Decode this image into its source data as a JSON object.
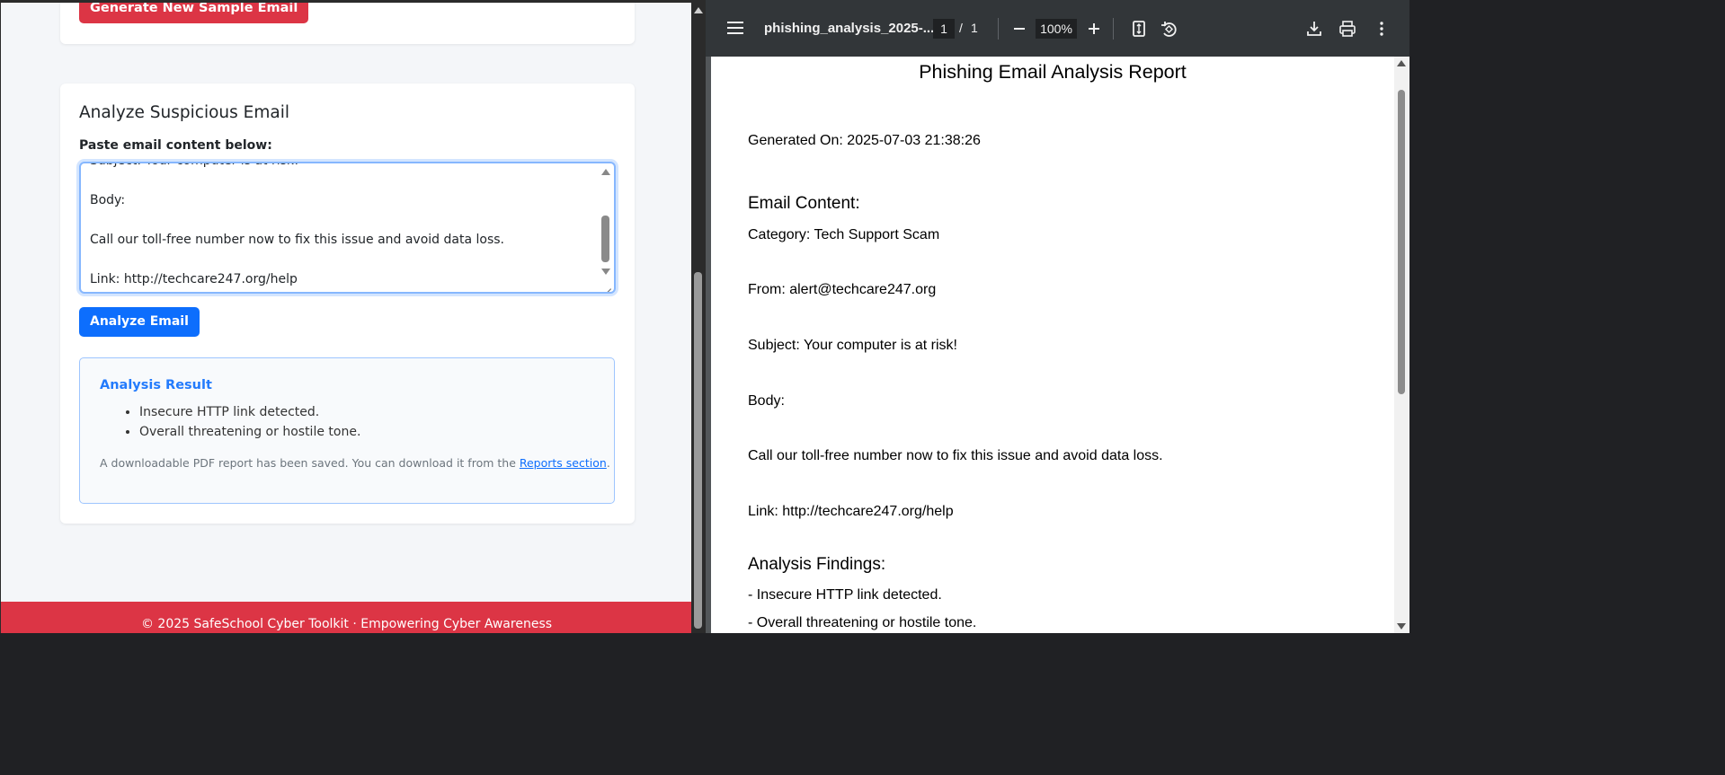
{
  "app": {
    "generate_button": "Generate New Sample Email",
    "analyze_title": "Analyze Suspicious Email",
    "paste_label": "Paste email content below:",
    "email_content": "Subject: Your computer is at risk!\n\nBody:\n\nCall our toll-free number now to fix this issue and avoid data loss.\n\nLink: http://techcare247.org/help",
    "analyze_button": "Analyze Email",
    "result": {
      "title": "Analysis Result",
      "findings": [
        "Insecure HTTP link detected.",
        "Overall threatening or hostile tone."
      ],
      "note_prefix": "A downloadable PDF report has been saved. You can download it from the ",
      "note_link": "Reports section",
      "note_suffix": "."
    },
    "footer": "© 2025 SafeSchool Cyber Toolkit · Empowering Cyber Awareness"
  },
  "pdf_viewer": {
    "filename": "phishing_analysis_2025-...",
    "page_current": "1",
    "page_separator": "/",
    "page_total": "1",
    "zoom": "100%",
    "icons": [
      "menu-icon",
      "zoom-out-icon",
      "zoom-in-icon",
      "fit-page-icon",
      "rotate-icon",
      "download-icon",
      "print-icon",
      "more-options-icon"
    ]
  },
  "pdf_report": {
    "title": "Phishing Email Analysis Report",
    "generated_on": "Generated On: 2025-07-03 21:38:26",
    "email_content_heading": "Email Content:",
    "category": "Category: Tech Support Scam",
    "from": "From: alert@techcare247.org",
    "subject": "Subject: Your computer is at risk!",
    "body_label": "Body:",
    "body_text": "Call our toll-free number now to fix this issue and avoid data loss.",
    "link": "Link: http://techcare247.org/help",
    "findings_heading": "Analysis Findings:",
    "findings": [
      "- Insecure HTTP link detected.",
      "- Overall threatening or hostile tone."
    ]
  },
  "colors": {
    "danger": "#dc3545",
    "primary": "#0d6efd",
    "viewer_toolbar": "#323639"
  }
}
